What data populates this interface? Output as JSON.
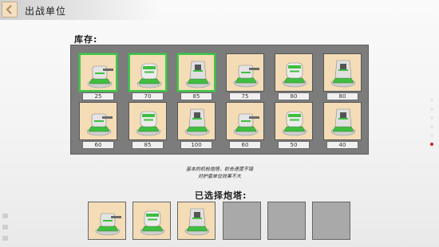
{
  "header": {
    "title": "出战单位",
    "back_icon": "back-arrow-icon"
  },
  "inventory": {
    "label": "库存:",
    "turrets": [
      {
        "price": "25",
        "selected": true,
        "icon": "machine-gun-turret-icon"
      },
      {
        "price": "70",
        "selected": true,
        "icon": "twin-gun-turret-icon"
      },
      {
        "price": "85",
        "selected": true,
        "icon": "cannon-turret-icon"
      },
      {
        "price": "75",
        "selected": false,
        "icon": "rapid-gun-turret-icon"
      },
      {
        "price": "80",
        "selected": false,
        "icon": "heavy-cannon-turret-icon"
      },
      {
        "price": "80",
        "selected": false,
        "icon": "dome-turret-icon"
      },
      {
        "price": "60",
        "selected": false,
        "icon": "missile-turret-icon"
      },
      {
        "price": "85",
        "selected": false,
        "icon": "laser-turret-icon"
      },
      {
        "price": "100",
        "selected": false,
        "icon": "artillery-turret-icon"
      },
      {
        "price": "60",
        "selected": false,
        "icon": "shield-turret-icon"
      },
      {
        "price": "50",
        "selected": false,
        "icon": "sensor-turret-icon"
      },
      {
        "price": "40",
        "selected": false,
        "icon": "mine-icon"
      }
    ]
  },
  "description": {
    "line1": "基本的机枪炮塔，射击速度不错",
    "line2": "对护盾单位效果不大"
  },
  "selected": {
    "label": "已选择炮塔:",
    "slots": [
      {
        "filled": true,
        "icon": "machine-gun-turret-icon"
      },
      {
        "filled": true,
        "icon": "twin-gun-turret-icon"
      },
      {
        "filled": true,
        "icon": "cannon-turret-icon"
      },
      {
        "filled": false
      },
      {
        "filled": false
      },
      {
        "filled": false
      }
    ]
  },
  "page_indicator": {
    "count": 6,
    "active": 5
  },
  "colors": {
    "select_border": "#3acb45",
    "slot_bg": "#f4dcb6",
    "panel_bg": "#7c7c7c",
    "turret_green": "#3fbf3f",
    "active_dot": "#d02020"
  }
}
